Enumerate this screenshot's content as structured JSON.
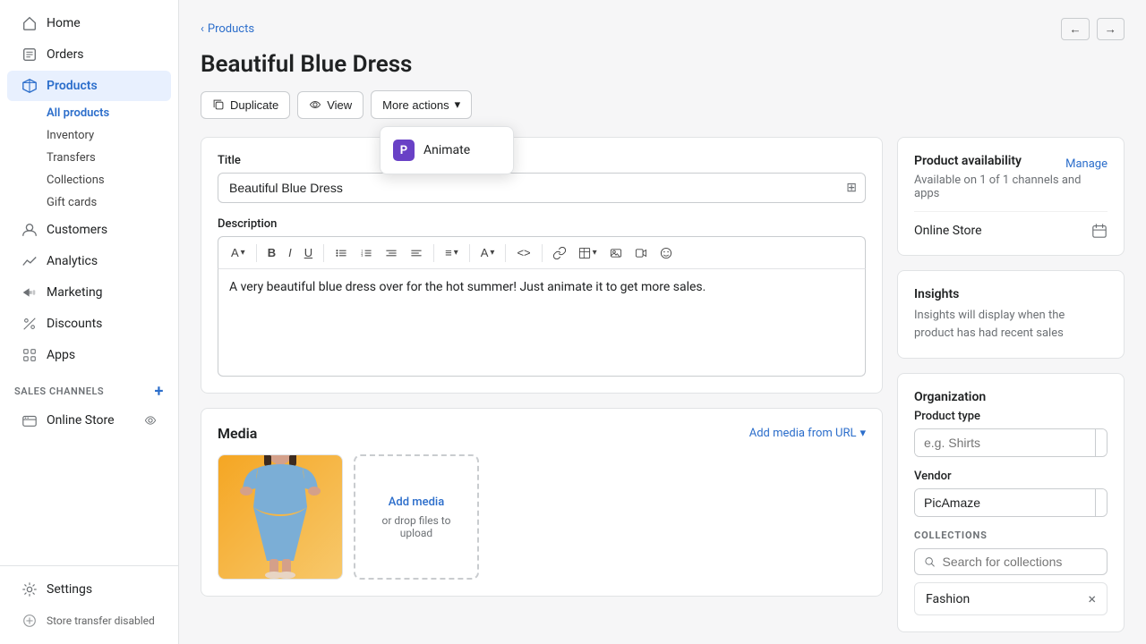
{
  "sidebar": {
    "items": [
      {
        "id": "home",
        "label": "Home",
        "icon": "home"
      },
      {
        "id": "orders",
        "label": "Orders",
        "icon": "orders"
      },
      {
        "id": "products",
        "label": "Products",
        "icon": "products"
      },
      {
        "id": "customers",
        "label": "Customers",
        "icon": "customers"
      },
      {
        "id": "analytics",
        "label": "Analytics",
        "icon": "analytics"
      },
      {
        "id": "marketing",
        "label": "Marketing",
        "icon": "marketing"
      },
      {
        "id": "discounts",
        "label": "Discounts",
        "icon": "discounts"
      },
      {
        "id": "apps",
        "label": "Apps",
        "icon": "apps"
      }
    ],
    "products_sub": [
      {
        "id": "all-products",
        "label": "All products",
        "active": true
      },
      {
        "id": "inventory",
        "label": "Inventory"
      },
      {
        "id": "transfers",
        "label": "Transfers"
      },
      {
        "id": "collections",
        "label": "Collections"
      },
      {
        "id": "gift-cards",
        "label": "Gift cards"
      }
    ],
    "sales_channels_title": "SALES CHANNELS",
    "sales_channels": [
      {
        "id": "online-store",
        "label": "Online Store"
      }
    ],
    "bottom": [
      {
        "id": "settings",
        "label": "Settings",
        "icon": "settings"
      },
      {
        "id": "store-transfer",
        "label": "Store transfer disabled",
        "icon": "transfer"
      }
    ]
  },
  "breadcrumb": "Products",
  "page_title": "Beautiful Blue Dress",
  "toolbar": {
    "duplicate": "Duplicate",
    "view": "View",
    "more_actions": "More actions",
    "dropdown_item": "Animate"
  },
  "product_form": {
    "title_label": "Title",
    "title_value": "Beautiful Blue Dress",
    "description_label": "Description",
    "description_text": "A very beautiful blue dress over for the hot summer! Just animate it to get more sales."
  },
  "media": {
    "title": "Media",
    "add_media_btn": "Add media from URL",
    "upload_text": "Add media",
    "upload_sub_1": "or drop files to",
    "upload_sub_2": "upload"
  },
  "right_panel": {
    "availability": {
      "title": "Product availability",
      "manage": "Manage",
      "subtitle": "Available on 1 of 1 channels and apps",
      "online_store": "Online Store"
    },
    "insights": {
      "title": "Insights",
      "text": "Insights will display when the product has had recent sales"
    },
    "organization": {
      "title": "Organization",
      "product_type_label": "Product type",
      "product_type_placeholder": "e.g. Shirts",
      "vendor_label": "Vendor",
      "vendor_value": "PicAmaze",
      "collections_label": "COLLECTIONS",
      "collections_placeholder": "Search for collections",
      "collection_tag": "Fashion"
    }
  }
}
